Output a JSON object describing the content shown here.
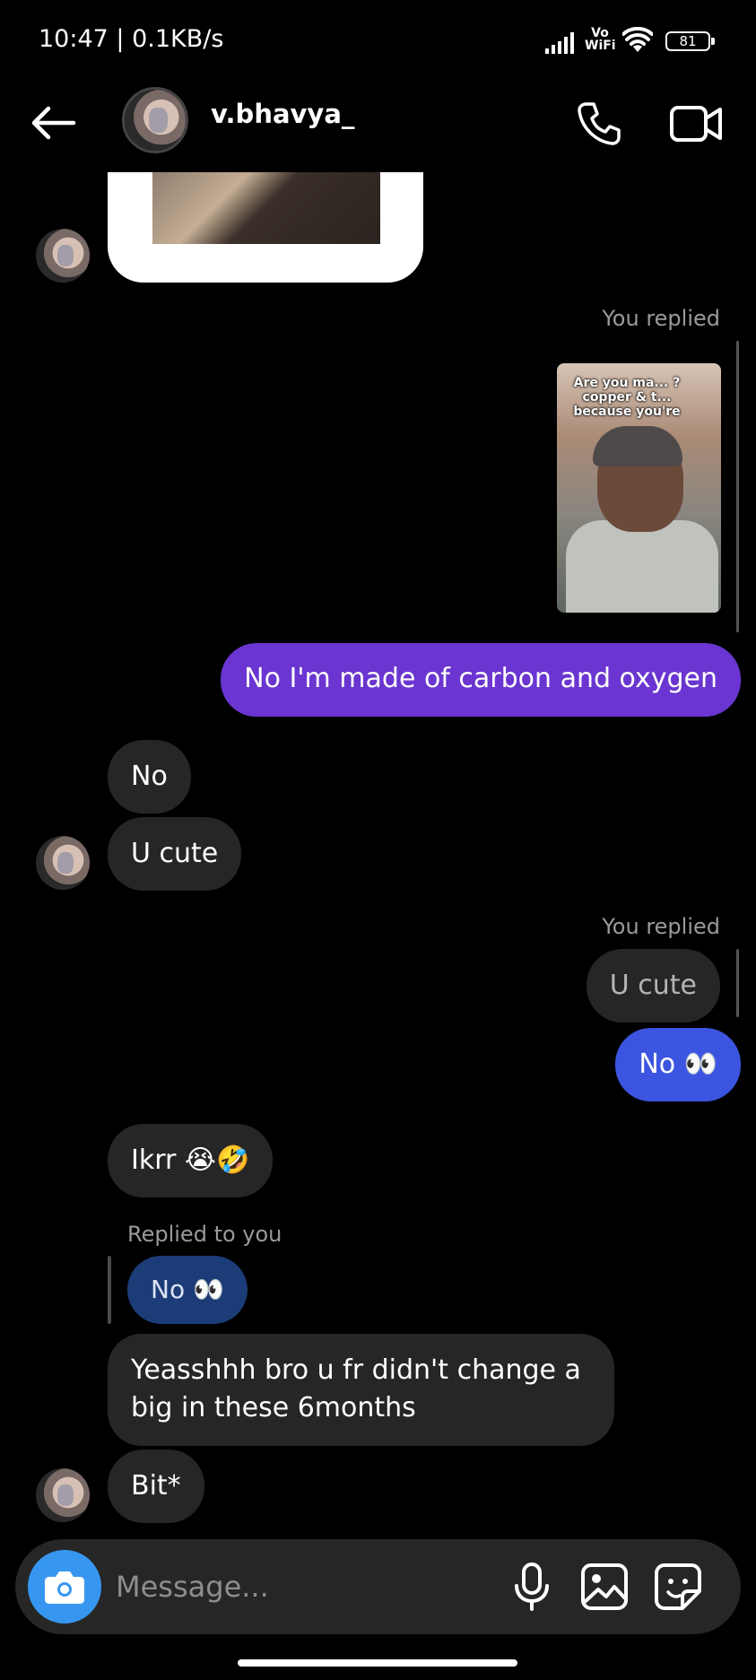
{
  "status_bar": {
    "time_speed": "10:47 | 0.1KB/s",
    "network_label_top": "Vo",
    "network_label_bottom": "WiFi",
    "battery": "81"
  },
  "header": {
    "username": "v.bhavya_"
  },
  "messages": {
    "reply_label_1": "You replied",
    "reel_caption": "Are you ma... ? copper & t... because you're",
    "outgoing_1": "No I'm made of carbon and oxygen",
    "incoming_1": "No",
    "incoming_2": "U cute",
    "reply_label_2": "You replied",
    "quoted_2": "U cute",
    "outgoing_2": "No 👀",
    "incoming_3": "Ikrr 😭🤣",
    "reply_label_3": "Replied to you",
    "quoted_3": "No 👀",
    "incoming_4_line1": "Yeasshhh bro u fr didn't change a",
    "incoming_4_line2": "big in these 6months",
    "incoming_5": "Bit*"
  },
  "composer": {
    "placeholder": "Message..."
  },
  "icons": {
    "back": "back-arrow-icon",
    "call": "phone-icon",
    "video": "video-camera-icon",
    "camera": "camera-icon",
    "mic": "microphone-icon",
    "gallery": "image-icon",
    "sticker": "sticker-icon"
  },
  "colors": {
    "outgoing_purple": "#6a35d0",
    "outgoing_blue": "#3c55e0",
    "incoming_bubble": "#262626",
    "camera_button": "#3797f0"
  }
}
